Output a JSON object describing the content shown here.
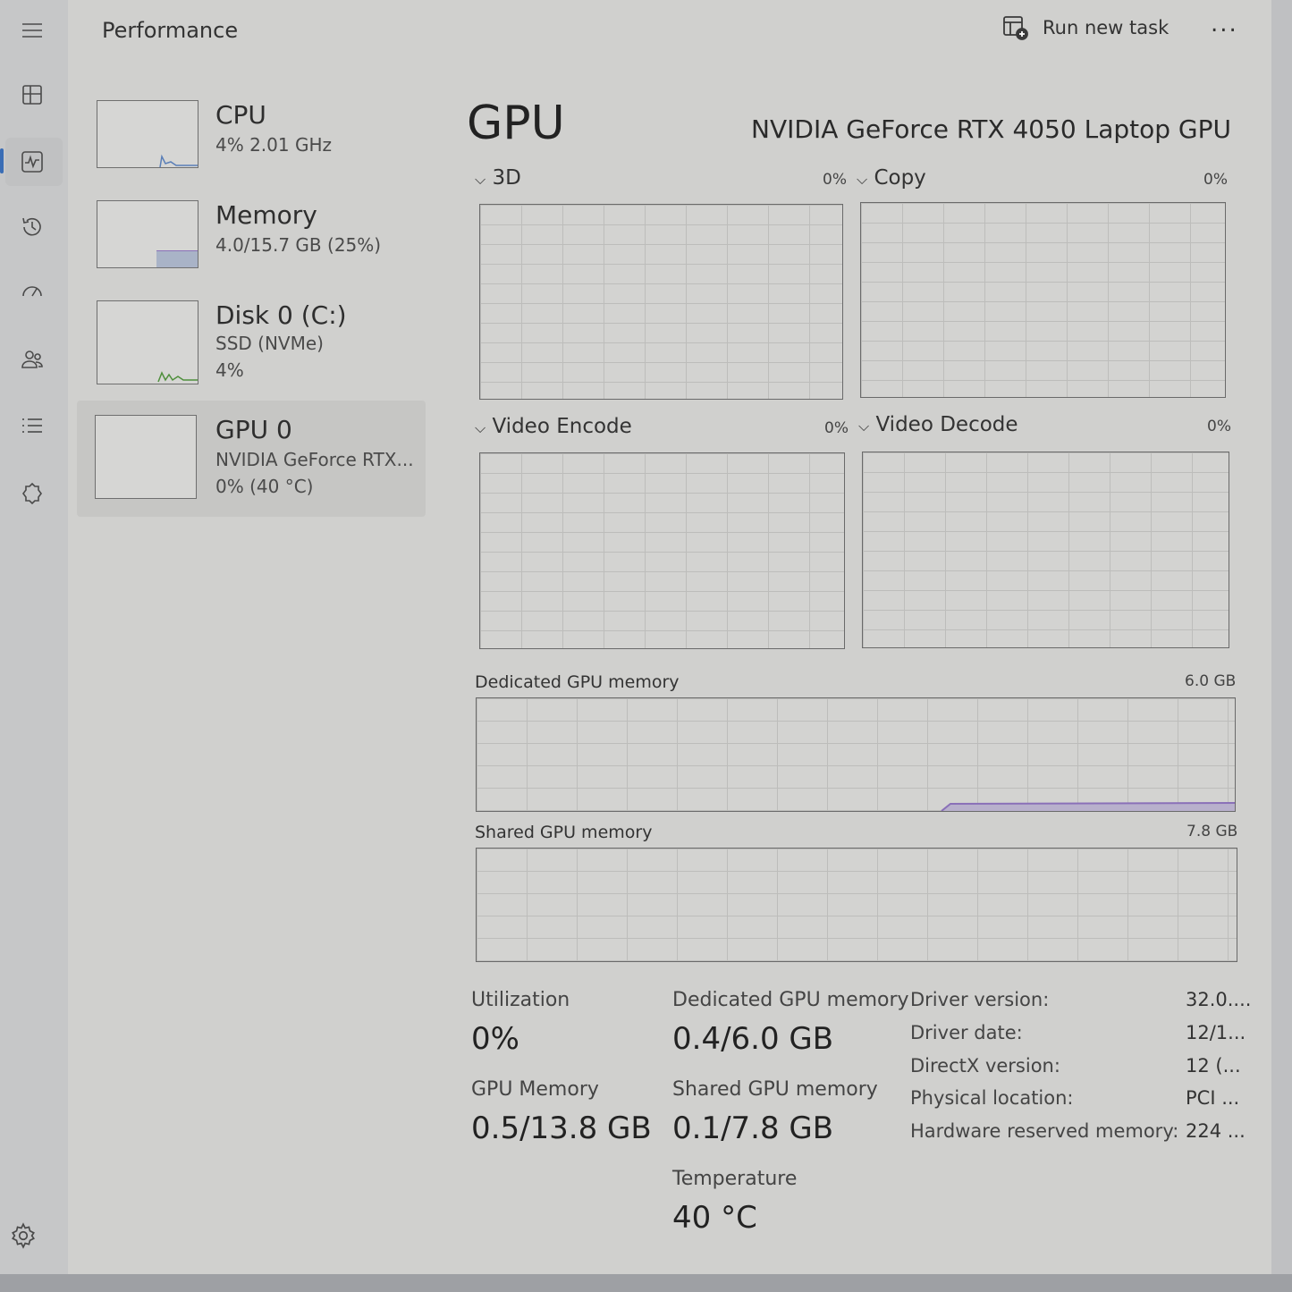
{
  "window": {
    "title": "Performance",
    "run_new_task": "Run new task",
    "more": "..."
  },
  "rail": {
    "items": [
      "menu-icon",
      "processes-icon",
      "performance-icon",
      "app-history-icon",
      "startup-apps-icon",
      "users-icon",
      "details-icon",
      "services-icon"
    ],
    "active": "performance-icon",
    "settings": "settings-icon"
  },
  "side": {
    "cpu": {
      "name": "CPU",
      "detail": "4%  2.01 GHz"
    },
    "memory": {
      "name": "Memory",
      "detail": "4.0/15.7 GB (25%)"
    },
    "disk": {
      "name": "Disk 0 (C:)",
      "detail1": "SSD (NVMe)",
      "detail2": "4%"
    },
    "gpu": {
      "name": "GPU 0",
      "detail1": "NVIDIA GeForce RTX...",
      "detail2": "0%  (40 °C)"
    }
  },
  "gpu": {
    "title": "GPU",
    "model": "NVIDIA GeForce RTX 4050 Laptop GPU",
    "engines": [
      {
        "label": "3D",
        "percent": "0%"
      },
      {
        "label": "Copy",
        "percent": "0%"
      },
      {
        "label": "Video Encode",
        "percent": "0%"
      },
      {
        "label": "Video Decode",
        "percent": "0%"
      }
    ],
    "dedicated_graph": {
      "label": "Dedicated GPU memory",
      "max": "6.0 GB"
    },
    "shared_graph": {
      "label": "Shared GPU memory",
      "max": "7.8 GB"
    },
    "stats": {
      "utilization_label": "Utilization",
      "utilization": "0%",
      "dedicated_label": "Dedicated GPU memory",
      "dedicated": "0.4/6.0 GB",
      "gpu_memory_label": "GPU Memory",
      "gpu_memory": "0.5/13.8 GB",
      "shared_label": "Shared GPU memory",
      "shared": "0.1/7.8 GB",
      "temperature_label": "Temperature",
      "temperature": "40 °C"
    },
    "info": [
      {
        "key": "Driver version:",
        "value": "32.0...."
      },
      {
        "key": "Driver date:",
        "value": "12/1..."
      },
      {
        "key": "DirectX version:",
        "value": "12 (..."
      },
      {
        "key": "Physical location:",
        "value": "PCI ..."
      },
      {
        "key": "Hardware reserved memory:",
        "value": "224 ..."
      }
    ]
  },
  "colors": {
    "accent": "#3a6db5",
    "memory_line": "#8a70b8",
    "disk_line": "#4f8f3c"
  }
}
